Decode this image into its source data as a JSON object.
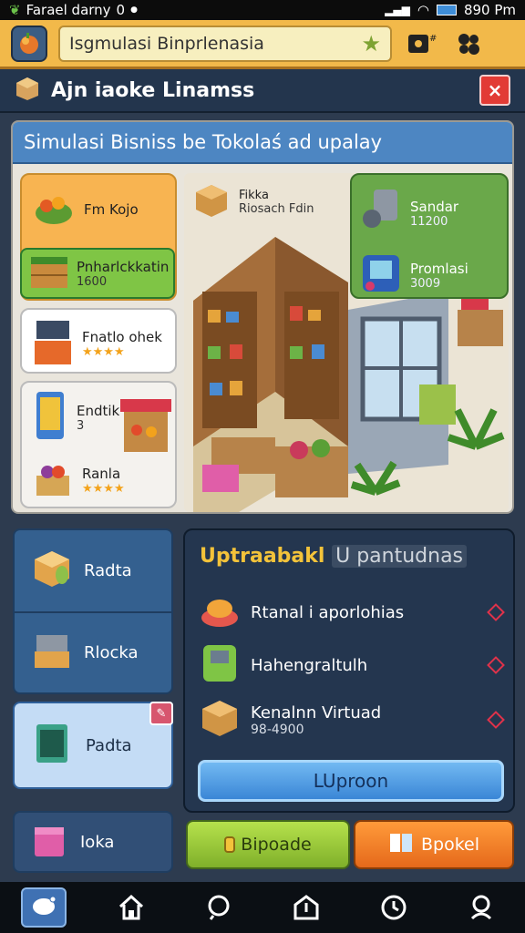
{
  "status_bar": {
    "left_text": "Farael darny",
    "left_mark": "0",
    "time": "890 Pm"
  },
  "app_bar": {
    "search_value": "Isgmulasi Binprlenasia",
    "star_icon": "star-icon",
    "grid_icon": "gamepad-icon",
    "apps_icon": "puzzle-icon"
  },
  "title_bar": {
    "title": "Ajn iaoke Linamss",
    "close_label": "×"
  },
  "main_panel": {
    "header": "Simulasi Bisniss be Tokolaś ad upalay",
    "cards": [
      {
        "label": "Fm Kojo"
      },
      {
        "label": "Pnharlckkatin",
        "value": "1600"
      },
      {
        "label": "Fnatlo ohek",
        "rating": "★★★★"
      },
      {
        "label": "Endtik",
        "value": "3"
      },
      {
        "label": "Ranla",
        "rating": "★★★★"
      }
    ],
    "scene_box": {
      "label": "Fikka",
      "sub": "Riosach Fdin"
    },
    "right_cards": [
      {
        "label": "Sandar",
        "value": "11200"
      },
      {
        "label": "Promlasi",
        "value": "3009"
      }
    ]
  },
  "left_menu": [
    {
      "label": "Radta"
    },
    {
      "label": "Rlocka"
    }
  ],
  "left_button": {
    "label": "Padta",
    "badge": "✎"
  },
  "left_button2": {
    "label": "Ioka"
  },
  "upgrade_panel": {
    "title": "Uptraabakl",
    "title_suffix": "U pantudnas",
    "items": [
      {
        "label": "Rtanal i aporlohias"
      },
      {
        "label": "Hahengraltulh"
      },
      {
        "label": "Kenalnn Virtuad",
        "value": "98-4900"
      }
    ],
    "button": "LUproon"
  },
  "bottom_buttons": {
    "green": "Bipoade",
    "orange": "Bpokel"
  },
  "colors": {
    "accent": "#f2b94a",
    "panel": "#24364f",
    "header_blue": "#4d86c2",
    "green": "#7fc545",
    "orange": "#e5691b"
  }
}
